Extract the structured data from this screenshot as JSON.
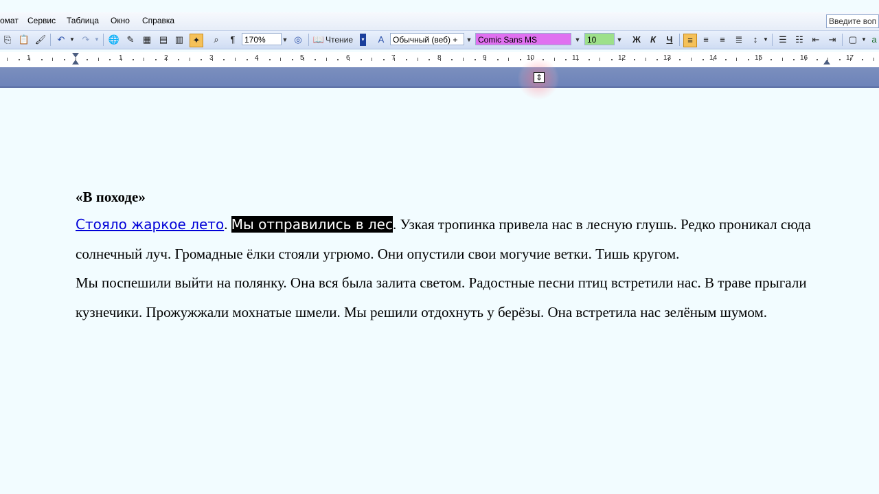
{
  "menu": [
    "омат",
    "Сервис",
    "Таблица",
    "Окно",
    "Справка"
  ],
  "help_search_placeholder": "Введите воп",
  "toolbar": {
    "zoom": "170%",
    "reading_label": "Чтение",
    "style_value": "Обычный (веб) +",
    "font_value": "Comic Sans MS",
    "size_value": "10",
    "bold": "Ж",
    "italic": "К",
    "underline": "Ч",
    "pilcrow": "¶"
  },
  "ruler_numbers": [
    "1",
    "1",
    "2",
    "3",
    "4",
    "5",
    "6",
    "7",
    "8",
    "9",
    "10",
    "11",
    "12",
    "13",
    "14",
    "15",
    "16",
    "17"
  ],
  "document": {
    "title": "«В походе»",
    "p1": {
      "link_text": "Стояло жаркое лето",
      "after_link": ". ",
      "selected_text": "Мы отправились в лес",
      "rest": ". Узкая тропинка привела нас в лесную глушь. Редко проникал сюда солнечный луч. Громадные ёлки стояли угрюмо. Они опустили свои могучие ветки. Тишь кругом."
    },
    "p2": "Мы поспешили выйти на полянку. Она вся была залита светом. Радостные песни птиц встретили нас. В траве прыгали кузнечики. Прожужжали мохнатые шмели. Мы решили отдохнуть у берёзы. Она встретила нас зелёным шумом."
  },
  "colors": {
    "font_highlight": "#e070f0",
    "size_highlight": "#9de08a",
    "band": "#7488bb",
    "link": "#0000d8"
  }
}
